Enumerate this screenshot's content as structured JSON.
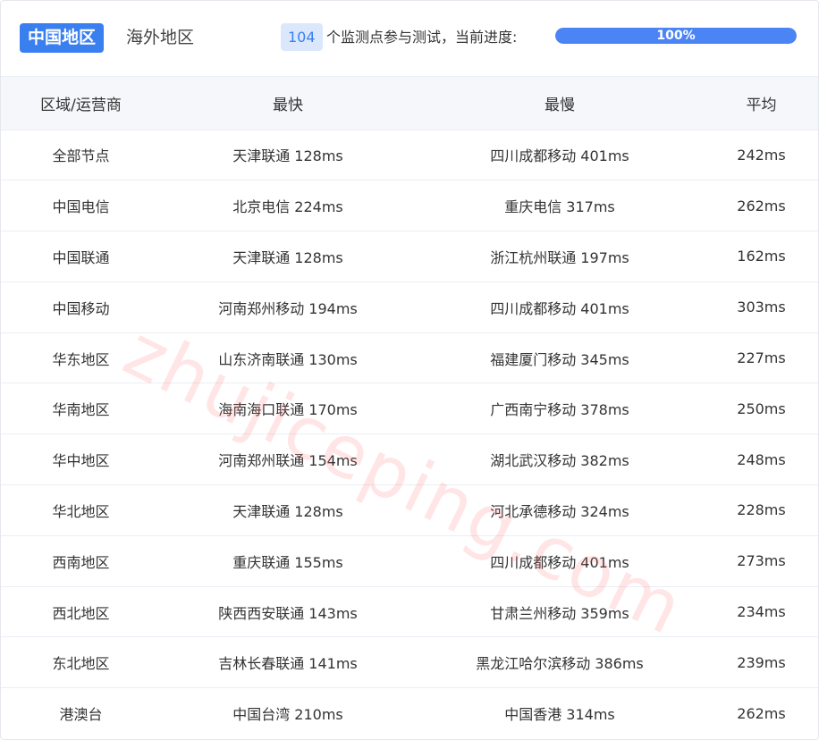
{
  "tabs": [
    {
      "label": "中国地区",
      "active": true
    },
    {
      "label": "海外地区",
      "active": false
    }
  ],
  "progress": {
    "count": "104",
    "text": "个监测点参与测试，当前进度:",
    "percent_label": "100%",
    "percent": 100
  },
  "table": {
    "headers": [
      "区域/运营商",
      "最快",
      "最慢",
      "平均"
    ],
    "rows": [
      [
        "全部节点",
        "天津联通 128ms",
        "四川成都移动 401ms",
        "242ms"
      ],
      [
        "中国电信",
        "北京电信 224ms",
        "重庆电信 317ms",
        "262ms"
      ],
      [
        "中国联通",
        "天津联通 128ms",
        "浙江杭州联通 197ms",
        "162ms"
      ],
      [
        "中国移动",
        "河南郑州移动 194ms",
        "四川成都移动 401ms",
        "303ms"
      ],
      [
        "华东地区",
        "山东济南联通 130ms",
        "福建厦门移动 345ms",
        "227ms"
      ],
      [
        "华南地区",
        "海南海口联通 170ms",
        "广西南宁移动 378ms",
        "250ms"
      ],
      [
        "华中地区",
        "河南郑州联通 154ms",
        "湖北武汉移动 382ms",
        "248ms"
      ],
      [
        "华北地区",
        "天津联通 128ms",
        "河北承德移动 324ms",
        "228ms"
      ],
      [
        "西南地区",
        "重庆联通 155ms",
        "四川成都移动 401ms",
        "273ms"
      ],
      [
        "西北地区",
        "陕西西安联通 143ms",
        "甘肃兰州移动 359ms",
        "234ms"
      ],
      [
        "东北地区",
        "吉林长春联通 141ms",
        "黑龙江哈尔滨移动 386ms",
        "239ms"
      ],
      [
        "港澳台",
        "中国台湾 210ms",
        "中国香港 314ms",
        "262ms"
      ]
    ]
  },
  "watermark": "zhujiceping.com",
  "colors": {
    "accent": "#3a7ff0",
    "badge_bg": "#dbe8fb",
    "header_bg": "#f5f7fa"
  }
}
